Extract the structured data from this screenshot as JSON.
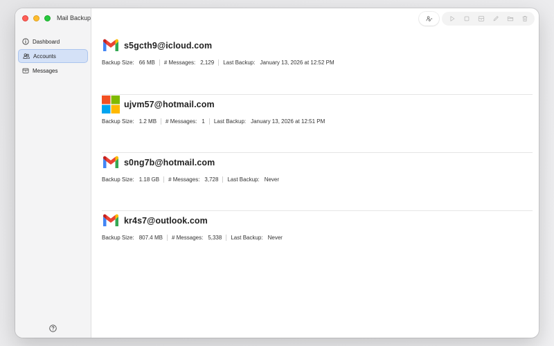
{
  "window": {
    "title": "Mail Backup"
  },
  "sidebar": {
    "items": [
      {
        "label": "Dashboard",
        "icon": "info-circle-icon",
        "active": false
      },
      {
        "label": "Accounts",
        "icon": "people-icon",
        "active": true
      },
      {
        "label": "Messages",
        "icon": "archive-box-icon",
        "active": false
      }
    ],
    "help_icon": "question-circle-icon"
  },
  "toolbar": {
    "buttons": [
      "add-account-icon",
      "play-icon",
      "stop-icon",
      "archive-icon",
      "pencil-icon",
      "folder-icon",
      "trash-icon"
    ]
  },
  "labels": {
    "backup_size": "Backup Size:",
    "messages": "# Messages:",
    "last_backup": "Last Backup:"
  },
  "accounts": [
    {
      "email": "s5gcth9@icloud.com",
      "provider": "gmail",
      "backup_size": "66 MB",
      "messages": "2,129",
      "last_backup": "January 13, 2026 at 12:52 PM"
    },
    {
      "email": "ujvm57@hotmail.com",
      "provider": "microsoft",
      "backup_size": "1.2 MB",
      "messages": "1",
      "last_backup": "January 13, 2026 at 12:51 PM"
    },
    {
      "email": "s0ng7b@hotmail.com",
      "provider": "gmail",
      "backup_size": "1.18 GB",
      "messages": "3,728",
      "last_backup": "Never"
    },
    {
      "email": "kr4s7@outlook.com",
      "provider": "gmail",
      "backup_size": "807.4 MB",
      "messages": "5,338",
      "last_backup": "Never"
    }
  ],
  "colors": {
    "accent_selection": "#d4e1f7",
    "gmail_red": "#ea4335",
    "gmail_blue": "#4285f4",
    "gmail_green": "#34a853",
    "gmail_yellow": "#fbbc04",
    "ms_red": "#f25022",
    "ms_green": "#7fba00",
    "ms_blue": "#00a4ef",
    "ms_yellow": "#ffb900"
  }
}
